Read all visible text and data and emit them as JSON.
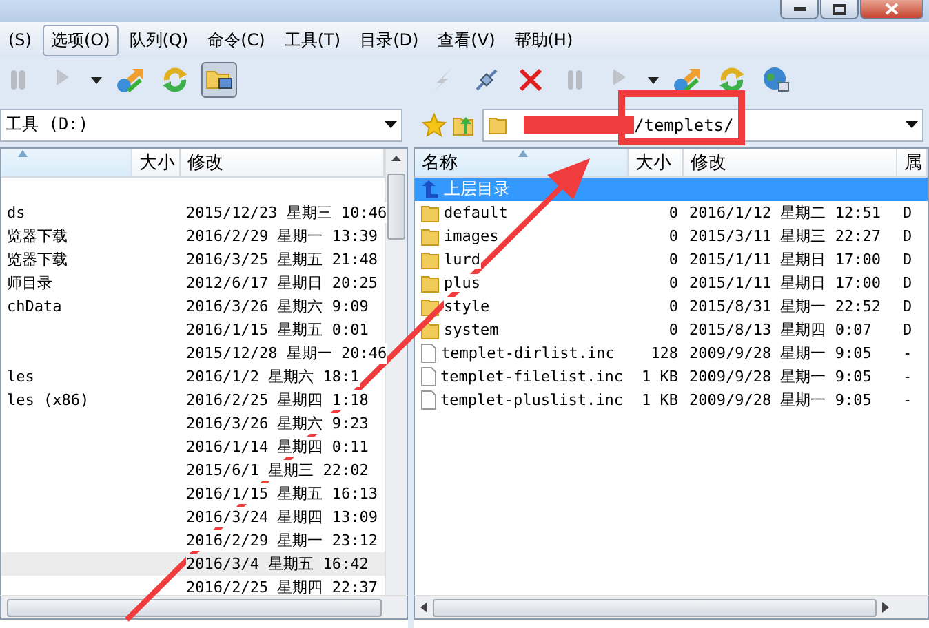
{
  "menu": [
    {
      "label": "(S)",
      "selected": false
    },
    {
      "label": "选项(O)",
      "selected": true
    },
    {
      "label": "队列(Q)",
      "selected": false
    },
    {
      "label": "命令(C)",
      "selected": false
    },
    {
      "label": "工具(T)",
      "selected": false
    },
    {
      "label": "目录(D)",
      "selected": false
    },
    {
      "label": "查看(V)",
      "selected": false
    },
    {
      "label": "帮助(H)",
      "selected": false
    }
  ],
  "left_pane": {
    "toolbar": [
      {
        "kind": "pause",
        "disabled": true,
        "pressed": false
      },
      {
        "kind": "play",
        "disabled": true,
        "pressed": false
      },
      {
        "kind": "dropdown",
        "disabled": false,
        "pressed": false
      },
      {
        "kind": "transfer",
        "disabled": false,
        "pressed": false
      },
      {
        "kind": "refresh",
        "disabled": false,
        "pressed": false
      },
      {
        "kind": "local-browser",
        "disabled": false,
        "pressed": true
      }
    ],
    "path": "工具 (D:)",
    "columns": [
      {
        "sorted": true
      },
      {
        "label": "大小",
        "sorted": false
      },
      {
        "label": "修改",
        "sorted": false
      }
    ],
    "rows": [
      {
        "selected": false
      },
      {
        "name": "ds",
        "modified": "2015/12/23 星期三 10:46",
        "selected": false
      },
      {
        "name": "览器下载",
        "modified": "2016/2/29 星期一 13:39",
        "selected": false
      },
      {
        "name": "览器下载",
        "modified": "2016/3/25 星期五 21:48",
        "selected": false
      },
      {
        "name": "师目录",
        "modified": "2012/6/17 星期日 20:25",
        "selected": false
      },
      {
        "name": "chData",
        "modified": "2016/3/26 星期六 9:09",
        "selected": false
      },
      {
        "modified": "2016/1/15 星期五 0:01",
        "selected": false
      },
      {
        "modified": "2015/12/28 星期一 20:46",
        "selected": false
      },
      {
        "name": "les",
        "modified": "2016/1/2 星期六 18:1",
        "selected": false
      },
      {
        "name": "les (x86)",
        "modified": "2016/2/25 星期四 1:18",
        "selected": false
      },
      {
        "modified": "2016/3/26 星期六 9:23",
        "selected": false
      },
      {
        "modified": "2016/1/14 星期四 0:11",
        "selected": false
      },
      {
        "modified": "2015/6/1 星期三 22:02",
        "selected": false
      },
      {
        "modified": "2016/1/15 星期五 16:13",
        "selected": false
      },
      {
        "modified": "2016/3/24 星期四 13:09",
        "selected": false
      },
      {
        "modified": "2016/2/29 星期一 23:12",
        "selected": false
      },
      {
        "modified": "2016/3/4 星期五 16:42",
        "selected": true
      },
      {
        "modified": "2016/2/25 星期四 22:37",
        "selected": false
      }
    ]
  },
  "right_pane": {
    "toolbar": [
      {
        "kind": "lightning",
        "disabled": true,
        "pressed": false
      },
      {
        "kind": "connect",
        "disabled": false,
        "pressed": false
      },
      {
        "kind": "disconnect",
        "disabled": false,
        "pressed": false
      },
      {
        "kind": "pause",
        "disabled": true,
        "pressed": false
      },
      {
        "kind": "play",
        "disabled": true,
        "pressed": false
      },
      {
        "kind": "dropdown",
        "disabled": false,
        "pressed": false
      },
      {
        "kind": "transfer",
        "disabled": false,
        "pressed": false
      },
      {
        "kind": "refresh",
        "disabled": false,
        "pressed": false
      },
      {
        "kind": "globe",
        "disabled": false,
        "pressed": false
      }
    ],
    "path": "/templets/",
    "columns": [
      {
        "label": "名称",
        "sorted": true
      },
      {
        "label": "大小",
        "sorted": false
      },
      {
        "label": "修改",
        "sorted": false
      },
      {
        "label": "属",
        "sorted": false
      }
    ],
    "rows": [
      {
        "kind": "up",
        "name": "上层目录",
        "selected": true
      },
      {
        "kind": "folder",
        "name": "default",
        "size": "0",
        "modified": "2016/1/12 星期二 12:51",
        "attributes": "D",
        "selected": false
      },
      {
        "kind": "folder",
        "name": "images",
        "size": "0",
        "modified": "2015/3/11 星期三 22:27",
        "attributes": "D",
        "selected": false
      },
      {
        "kind": "folder",
        "name": "lurd",
        "size": "0",
        "modified": "2015/1/11 星期日 17:00",
        "attributes": "D",
        "selected": false
      },
      {
        "kind": "folder",
        "name": "plus",
        "size": "0",
        "modified": "2015/1/11 星期日 17:00",
        "attributes": "D",
        "selected": false
      },
      {
        "kind": "folder",
        "name": "style",
        "size": "0",
        "modified": "2015/8/31 星期一 22:52",
        "attributes": "D",
        "selected": false
      },
      {
        "kind": "folder",
        "name": "system",
        "size": "0",
        "modified": "2015/8/13 星期四 0:07",
        "attributes": "D",
        "selected": false
      },
      {
        "kind": "file",
        "name": "templet-dirlist.inc",
        "size": "128",
        "modified": "2009/9/28 星期一 9:05",
        "attributes": "-",
        "selected": false
      },
      {
        "kind": "file",
        "name": "templet-filelist.inc",
        "size": "1 KB",
        "modified": "2009/9/28 星期一 9:05",
        "attributes": "-",
        "selected": false
      },
      {
        "kind": "file",
        "name": "templet-pluslist.inc",
        "size": "1 KB",
        "modified": "2009/9/28 星期一 9:05",
        "attributes": "-",
        "selected": false
      }
    ]
  }
}
